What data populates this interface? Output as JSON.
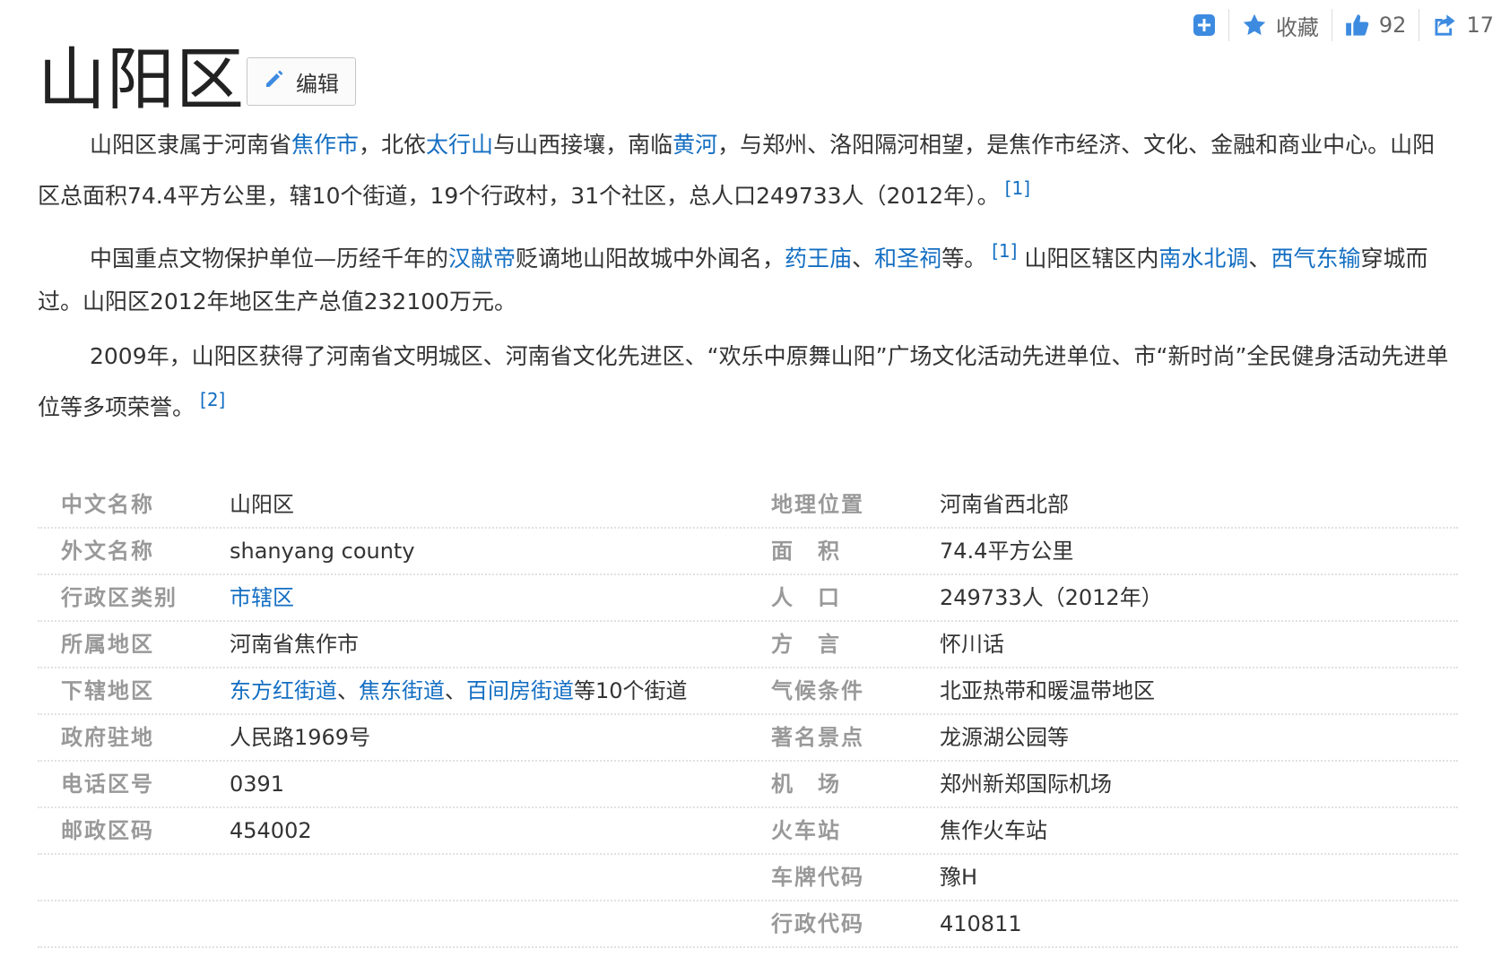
{
  "actions": {
    "collect_label": "收藏",
    "like_count": "92",
    "share_count": "17"
  },
  "title": "山阳区",
  "edit_label": "编辑",
  "p1": {
    "t1": "山阳区隶属于河南省",
    "l1": "焦作市",
    "t2": "，北依",
    "l2": "太行山",
    "t3": "与山西接壤，南临",
    "l3": "黄河",
    "t4": "，与郑州、洛阳隔河相望，是焦作市经济、文化、金融和商业中心。山阳区总面积74.4平方公里，辖10个街道，19个行政村，31个社区，总人口249733人（2012年）。",
    "ref": "[1]"
  },
  "p2": {
    "t1": "中国重点文物保护单位—历经千年的",
    "l1": "汉献帝",
    "t2": "贬谪地山阳故城中外闻名，",
    "l2": "药王庙",
    "t3": "、",
    "l3": "和圣祠",
    "t4": "等。",
    "ref": "[1]",
    "t5": " 山阳区辖区内",
    "l4": "南水北调",
    "t6": "、",
    "l5": "西气东输",
    "t7": "穿城而过。山阳区2012年地区生产总值232100万元。"
  },
  "p3": {
    "t1": "2009年，山阳区获得了河南省文明城区、河南省文化先进区、“欢乐中原舞山阳”广场文化活动先进单位、市“新时尚”全民健身活动先进单位等多项荣誉。",
    "ref": "[2]"
  },
  "info": {
    "left": [
      {
        "label": "中文名称",
        "value": "山阳区"
      },
      {
        "label": "外文名称",
        "value": "shanyang county"
      },
      {
        "label": "行政区类别",
        "value": "市辖区"
      },
      {
        "label": "所属地区",
        "value": "河南省焦作市"
      },
      {
        "label": "下辖地区",
        "links": [
          "东方红街道",
          "焦东街道",
          "百间房街道"
        ],
        "sep": "、",
        "tail": "等10个街道"
      },
      {
        "label": "政府驻地",
        "value": "人民路1969号"
      },
      {
        "label": "电话区号",
        "value": "0391"
      },
      {
        "label": "邮政区码",
        "value": "454002"
      }
    ],
    "right": [
      {
        "label": "地理位置",
        "value": "河南省西北部"
      },
      {
        "label": "面　积",
        "value": "74.4平方公里"
      },
      {
        "label": "人　口",
        "value": "249733人（2012年）"
      },
      {
        "label": "方　言",
        "value": "怀川话"
      },
      {
        "label": "气候条件",
        "value": "北亚热带和暖温带地区"
      },
      {
        "label": "著名景点",
        "value": "龙源湖公园等"
      },
      {
        "label": "机　场",
        "value": "郑州新郑国际机场"
      },
      {
        "label": "火车站",
        "value": "焦作火车站"
      },
      {
        "label": "车牌代码",
        "value": "豫H"
      },
      {
        "label": "行政代码",
        "value": "410811"
      }
    ]
  },
  "colors": {
    "link": "#136ec2",
    "icon": "#3d8be0",
    "label": "#999999",
    "text": "#333333"
  }
}
